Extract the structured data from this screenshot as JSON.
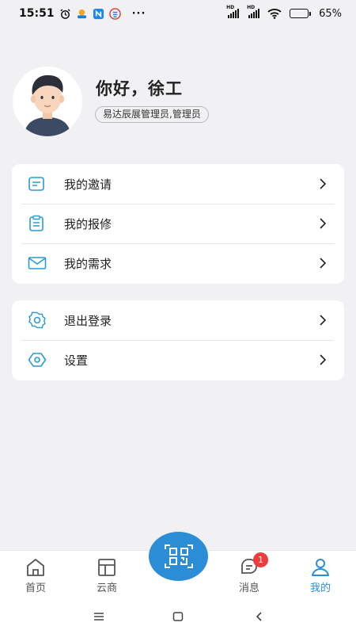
{
  "status_bar": {
    "time": "15:51",
    "battery_percent": "65%",
    "battery_level": 0.65,
    "dots": "···",
    "signal1_label": "HD",
    "signal2_label": "HD",
    "icons": [
      "alarm-icon",
      "app-notification-icon",
      "nfc-icon",
      "app-icon",
      "signal-icon",
      "signal-icon",
      "wifi-icon",
      "battery-icon"
    ]
  },
  "profile": {
    "greeting": "你好，徐工",
    "role": "易达辰展管理员,管理员"
  },
  "menu_group1": [
    {
      "label": "我的邀请",
      "icon": "invitation-icon"
    },
    {
      "label": "我的报修",
      "icon": "repair-clipboard-icon"
    },
    {
      "label": "我的需求",
      "icon": "mail-envelope-icon"
    }
  ],
  "menu_group2": [
    {
      "label": "退出登录",
      "icon": "logout-gear-icon"
    },
    {
      "label": "设置",
      "icon": "settings-hexagon-icon"
    }
  ],
  "tabbar": {
    "home": "首页",
    "shop": "云商",
    "messages": "消息",
    "messages_badge": "1",
    "me": "我的",
    "active": "me"
  },
  "colors": {
    "accent": "#2b8dd6",
    "badge": "#ee3b3b",
    "background": "#f1f1f3"
  }
}
